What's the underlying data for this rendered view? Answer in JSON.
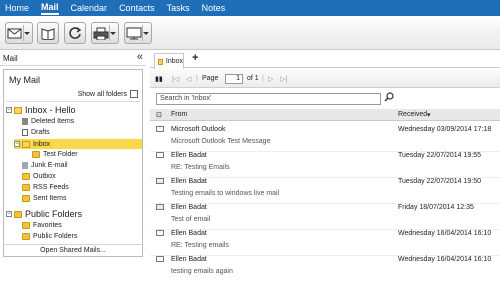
{
  "nav": {
    "items": [
      "Home",
      "Mail",
      "Calendar",
      "Contacts",
      "Tasks",
      "Notes"
    ],
    "active": "Mail"
  },
  "toolbar": {
    "buttons": [
      "new-mail-icon",
      "address-book-icon",
      "refresh-icon",
      "print-icon",
      "display-icon"
    ]
  },
  "left": {
    "header": "Mail",
    "my_mail": "My Mail",
    "show_all_folders": "Show all folders",
    "tree": [
      {
        "label": "Inbox - Hello",
        "level": 0,
        "bold": true
      },
      {
        "label": "Deleted Items",
        "level": 1
      },
      {
        "label": "Drafts",
        "level": 1
      },
      {
        "label": "Inbox",
        "level": 1,
        "selected": true
      },
      {
        "label": "Test Folder",
        "level": 2
      },
      {
        "label": "Junk E-mail",
        "level": 1
      },
      {
        "label": "Outbox",
        "level": 1
      },
      {
        "label": "RSS Feeds",
        "level": 1
      },
      {
        "label": "Sent Items",
        "level": 1
      },
      {
        "label": "Public Folders",
        "level": 0,
        "bold": true
      },
      {
        "label": "Favorites",
        "level": 1
      },
      {
        "label": "Public Folders",
        "level": 1
      }
    ],
    "open_shared": "Open Shared Mails..."
  },
  "tabs": {
    "active": "Inbox",
    "add": "+"
  },
  "pager": {
    "page_label": "Page",
    "page_value": "1",
    "of_label": "of 1"
  },
  "search": {
    "value": "Search in 'Inbox'"
  },
  "columns": {
    "from": "From",
    "received": "Received"
  },
  "messages": [
    {
      "from": "Microsoft Outlook",
      "subject": "Microsoft Outlook Test Message",
      "date": "Wednesday 03/09/2014 17:18"
    },
    {
      "from": "Ellen Badat",
      "subject": "RE: Testing Emails",
      "date": "Tuesday 22/07/2014 19:55"
    },
    {
      "from": "Ellen Badat",
      "subject": "Testing emails to windows live mail",
      "date": "Tuesday 22/07/2014 19:50"
    },
    {
      "from": "Ellen Badat",
      "subject": "Test of email",
      "date": "Friday 18/07/2014 12:35"
    },
    {
      "from": "Ellen Badat",
      "subject": "RE: Testing emails",
      "date": "Wednesday 16/04/2014 16:10"
    },
    {
      "from": "Ellen Badat",
      "subject": "testing emails again",
      "date": "Wednesday 16/04/2014 16:10"
    }
  ]
}
